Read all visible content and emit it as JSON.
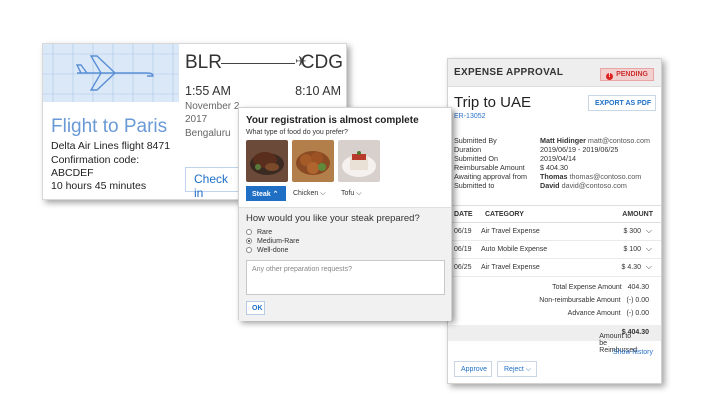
{
  "flight": {
    "title": "Flight to Paris",
    "airline": "Delta Air Lines flight 8471",
    "confirmation_label": "Confirmation code:",
    "confirmation_code": "ABCDEF",
    "duration": "10 hours 45 minutes",
    "origin": "BLR",
    "destination": "CDG",
    "depart_time": "1:55 AM",
    "arrive_time": "8:10 AM",
    "depart_date_line1": "November 2",
    "depart_date_line2": "2017",
    "depart_city": "Bengaluru",
    "checkin_label": "Check in",
    "hero_color": "#dbe8f7"
  },
  "registration": {
    "title": "Your registration is almost complete",
    "food_question": "What type of food do you prefer?",
    "food_options": [
      "Steak",
      "Chicken",
      "Tofu"
    ],
    "selected_food": "Steak",
    "prep_question": "How would you like your steak prepared?",
    "prep_options": [
      "Rare",
      "Medium-Rare",
      "Well-done"
    ],
    "selected_prep": "Medium-Rare",
    "requests_placeholder": "Any other preparation requests?",
    "ok_label": "OK"
  },
  "expense": {
    "header": "EXPENSE APPROVAL",
    "status": "PENDING",
    "status_color": "#cc3333",
    "title": "Trip to UAE",
    "report_code": "ER-13052",
    "export_label": "EXPORT AS PDF",
    "details": [
      {
        "label": "Submitted By",
        "name": "Matt Hidinger",
        "extra": "matt@contoso.com"
      },
      {
        "label": "Duration",
        "name": "",
        "extra": "2019/06/19 - 2019/06/25"
      },
      {
        "label": "Submitted On",
        "name": "",
        "extra": "2019/04/14"
      },
      {
        "label": "Reimbursable Amount",
        "name": "",
        "extra": "$ 404.30"
      },
      {
        "label": "Awaiting approval from",
        "name": "Thomas",
        "extra": "thomas@contoso.com"
      },
      {
        "label": "Submitted to",
        "name": "David",
        "extra": "david@contoso.com"
      }
    ],
    "columns": [
      "DATE",
      "CATEGORY",
      "AMOUNT"
    ],
    "rows": [
      {
        "date": "06/19",
        "category": "Air Travel Expense",
        "amount": "$ 300"
      },
      {
        "date": "06/19",
        "category": "Auto Mobile Expense",
        "amount": "$ 100"
      },
      {
        "date": "06/25",
        "category": "Air Travel Expense",
        "amount": "$ 4.30"
      }
    ],
    "total_label": "Total Expense Amount",
    "total_value": "404.30",
    "nonreimb_label": "Non-reimbursable Amount",
    "nonreimb_value": "(-) 0.00",
    "advance_label": "Advance Amount",
    "advance_value": "(-) 0.00",
    "reimburse_label": "Amount to be Reimbursed",
    "reimburse_value": "$ 404.30",
    "history_label": "Show history",
    "approve_label": "Approve",
    "reject_label": "Reject"
  }
}
